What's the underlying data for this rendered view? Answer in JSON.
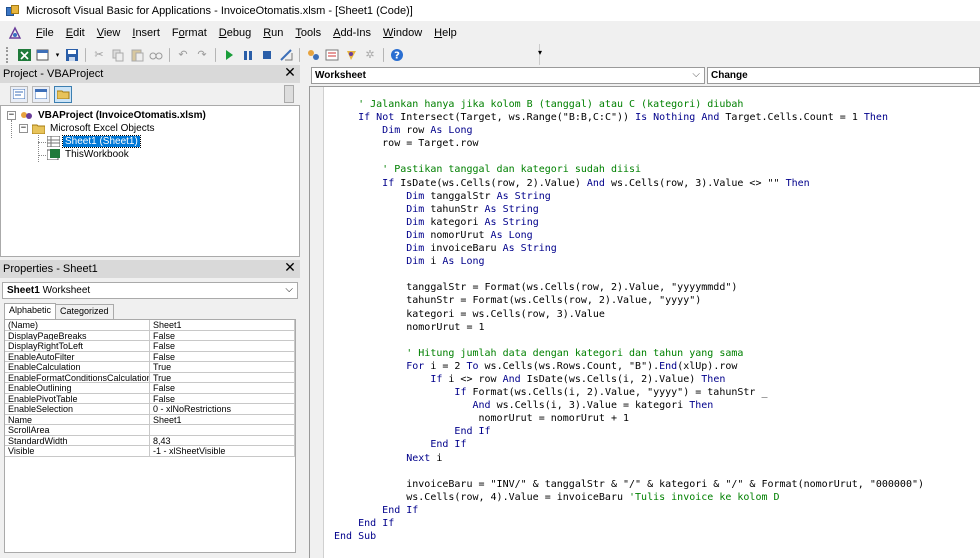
{
  "window": {
    "title": "Microsoft Visual Basic for Applications - InvoiceOtomatis.xlsm - [Sheet1 (Code)]"
  },
  "menu": [
    {
      "label": "File",
      "name": "menu-file"
    },
    {
      "label": "Edit",
      "name": "menu-edit"
    },
    {
      "label": "View",
      "name": "menu-view"
    },
    {
      "label": "Insert",
      "name": "menu-insert"
    },
    {
      "label": "Format",
      "name": "menu-format"
    },
    {
      "label": "Debug",
      "name": "menu-debug"
    },
    {
      "label": "Run",
      "name": "menu-run"
    },
    {
      "label": "Tools",
      "name": "menu-tools"
    },
    {
      "label": "Add-Ins",
      "name": "menu-add-ins"
    },
    {
      "label": "Window",
      "name": "menu-window"
    },
    {
      "label": "Help",
      "name": "menu-help"
    }
  ],
  "project": {
    "title": "Project - VBAProject",
    "tree": {
      "root": "VBAProject (InvoiceOtomatis.xlsm)",
      "folder": "Microsoft Excel Objects",
      "sheet": "Sheet1 (Sheet1)",
      "workbook": "ThisWorkbook"
    }
  },
  "properties": {
    "title": "Properties - Sheet1",
    "object_name": "Sheet1",
    "object_type": "Worksheet",
    "tabs": {
      "alphabetic": "Alphabetic",
      "categorized": "Categorized"
    },
    "rows": [
      {
        "name": "(Name)",
        "value": "Sheet1"
      },
      {
        "name": "DisplayPageBreaks",
        "value": "False"
      },
      {
        "name": "DisplayRightToLeft",
        "value": "False"
      },
      {
        "name": "EnableAutoFilter",
        "value": "False"
      },
      {
        "name": "EnableCalculation",
        "value": "True"
      },
      {
        "name": "EnableFormatConditionsCalculation",
        "value": "True"
      },
      {
        "name": "EnableOutlining",
        "value": "False"
      },
      {
        "name": "EnablePivotTable",
        "value": "False"
      },
      {
        "name": "EnableSelection",
        "value": "0 - xlNoRestrictions"
      },
      {
        "name": "Name",
        "value": "Sheet1"
      },
      {
        "name": "ScrollArea",
        "value": ""
      },
      {
        "name": "StandardWidth",
        "value": "8,43"
      },
      {
        "name": "Visible",
        "value": "-1 - xlSheetVisible"
      }
    ]
  },
  "code_window": {
    "object_combo": "Worksheet",
    "procedure_combo": "Change",
    "lines": [
      "    ' Jalankan hanya jika kolom B (tanggal) atau C (kategori) diubah",
      "    If Not Intersect(Target, ws.Range(\"B:B,C:C\")) Is Nothing And Target.Cells.Count = 1 Then",
      "        Dim row As Long",
      "        row = Target.row",
      "",
      "        ' Pastikan tanggal dan kategori sudah diisi",
      "        If IsDate(ws.Cells(row, 2).Value) And ws.Cells(row, 3).Value <> \"\" Then",
      "            Dim tanggalStr As String",
      "            Dim tahunStr As String",
      "            Dim kategori As String",
      "            Dim nomorUrut As Long",
      "            Dim invoiceBaru As String",
      "            Dim i As Long",
      "",
      "            tanggalStr = Format(ws.Cells(row, 2).Value, \"yyyymmdd\")",
      "            tahunStr = Format(ws.Cells(row, 2).Value, \"yyyy\")",
      "            kategori = ws.Cells(row, 3).Value",
      "            nomorUrut = 1",
      "",
      "            ' Hitung jumlah data dengan kategori dan tahun yang sama",
      "            For i = 2 To ws.Cells(ws.Rows.Count, \"B\").End(xlUp).row",
      "                If i <> row And IsDate(ws.Cells(i, 2).Value) Then",
      "                    If Format(ws.Cells(i, 2).Value, \"yyyy\") = tahunStr _",
      "                       And ws.Cells(i, 3).Value = kategori Then",
      "                        nomorUrut = nomorUrut + 1",
      "                    End If",
      "                End If",
      "            Next i",
      "",
      "            invoiceBaru = \"INV/\" & tanggalStr & \"/\" & kategori & \"/\" & Format(nomorUrut, \"000000\")",
      "            ws.Cells(row, 4).Value = invoiceBaru 'Tulis invoice ke kolom D",
      "        End If",
      "    End If",
      "End Sub"
    ]
  },
  "colors": {
    "keyword": "#00008b",
    "comment": "#008000",
    "selection": "#0078d7"
  }
}
